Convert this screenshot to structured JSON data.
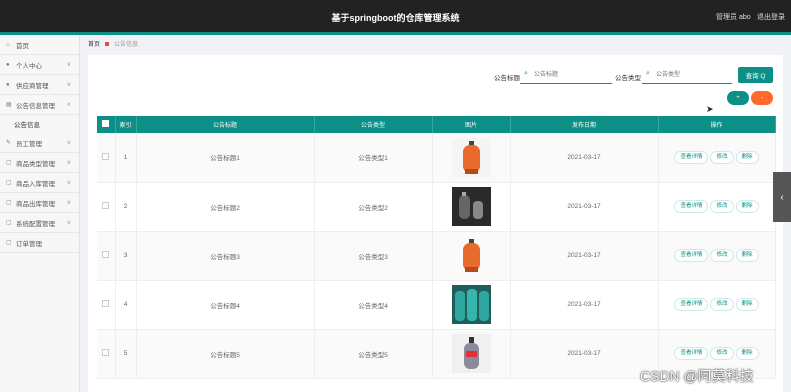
{
  "header": {
    "title": "基于springboot的仓库管理系统",
    "user": "管理员 abo",
    "logout": "退出登录"
  },
  "sidebar": {
    "items": [
      {
        "label": "首页",
        "icon": "home-icon",
        "has_chevron": false
      },
      {
        "label": "个人中心",
        "icon": "user-icon",
        "has_chevron": true
      },
      {
        "label": "供应商管理",
        "icon": "user-icon",
        "has_chevron": true
      },
      {
        "label": "公告信息管理",
        "icon": "file-icon",
        "has_chevron": true
      },
      {
        "label": "公告信息",
        "sub": true
      },
      {
        "label": "员工管理",
        "icon": "pin-icon",
        "has_chevron": true
      },
      {
        "label": "商品类型管理",
        "icon": "box-icon",
        "has_chevron": true
      },
      {
        "label": "商品入库管理",
        "icon": "box-icon",
        "has_chevron": true
      },
      {
        "label": "商品出库管理",
        "icon": "box-icon",
        "has_chevron": true
      },
      {
        "label": "系统配置管理",
        "icon": "box-icon",
        "has_chevron": true
      },
      {
        "label": "订单管理",
        "icon": "box-icon",
        "has_chevron": false
      }
    ]
  },
  "breadcrumb": {
    "home": "首页",
    "current": "公告信息"
  },
  "search": {
    "field1_label": "公告标题",
    "field1_placeholder": "公告标题",
    "field2_label": "公告类型",
    "field2_placeholder": "公告类型",
    "button": "查询 Q"
  },
  "actions": {
    "add": "+",
    "delete": "-"
  },
  "table": {
    "headers": [
      "",
      "索引",
      "公告标题",
      "公告类型",
      "图片",
      "发布日期",
      "操作"
    ],
    "rows": [
      {
        "index": "1",
        "title": "公告标题1",
        "type": "公告类型1",
        "date": "2021-03-17",
        "img_color": "#e86a2c"
      },
      {
        "index": "2",
        "title": "公告标题2",
        "type": "公告类型2",
        "date": "2021-03-17",
        "img_color": "#555555"
      },
      {
        "index": "3",
        "title": "公告标题3",
        "type": "公告类型3",
        "date": "2021-03-17",
        "img_color": "#e86a2c"
      },
      {
        "index": "4",
        "title": "公告标题4",
        "type": "公告类型4",
        "date": "2021-03-17",
        "img_color": "#2fa7a0"
      },
      {
        "index": "5",
        "title": "公告标题5",
        "type": "公告类型5",
        "date": "2021-03-17",
        "img_color": "#8a8a9a"
      }
    ],
    "row_actions": [
      "查看详情",
      "修改",
      "删除"
    ]
  },
  "watermark": "CSDN @阿莫科技",
  "colors": {
    "primary": "#0b8f86",
    "danger": "#ff6a2c",
    "topbar": "#222222"
  }
}
